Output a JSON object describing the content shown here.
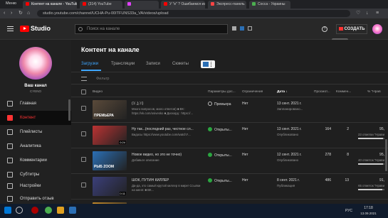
{
  "browser": {
    "menu_label": "Меню",
    "tabs": [
      {
        "label": "Контент на канале - YouTube",
        "color": "#ff0000"
      },
      {
        "label": "(314) YouTube",
        "color": "#ff0000"
      },
      {
        "label": "",
        "color": "#e040fb"
      },
      {
        "label": "У \"е\" ? Ошибаемся из-сол",
        "color": "#ff0000"
      },
      {
        "label": "Экспресс-панель",
        "color": "#ff4444"
      },
      {
        "label": "Сосса - Украины",
        "color": "#4caf50"
      }
    ],
    "url": "studio.youtube.com/channel/UCHA-Pu-00ITFUNS33a_VA/videos/upload"
  },
  "header": {
    "logo_text": "Studio",
    "search_placeholder": "Поиск на канале",
    "create_label": "СОЗДАТЬ",
    "create_tooltip": "Создать"
  },
  "sidebar": {
    "channel_name": "Ваш канал",
    "channel_sub": "CYENO",
    "items": [
      {
        "label": "Главная",
        "icon": "dashboard-icon"
      },
      {
        "label": "Контент",
        "icon": "content-icon",
        "active": true
      },
      {
        "label": "Плейлисты",
        "icon": "playlist-icon"
      },
      {
        "label": "Аналитика",
        "icon": "analytics-icon"
      },
      {
        "label": "Комментарии",
        "icon": "comments-icon"
      },
      {
        "label": "Субтитры",
        "icon": "subtitles-icon"
      },
      {
        "label": "Настройки",
        "icon": "settings-icon"
      },
      {
        "label": "Отправить отзыв",
        "icon": "feedback-icon"
      }
    ]
  },
  "main": {
    "title": "Контент на канале",
    "tabs": [
      "Загрузки",
      "Трансляции",
      "Записи",
      "Сюжеты"
    ],
    "filter_label": "Фильтр",
    "columns": {
      "video": "Видео",
      "visibility": "Параметры дос...",
      "restrictions": "Ограничения",
      "date": "Дата",
      "views": "Просмот...",
      "comments": "Коммен...",
      "likes": "% \"Нрав"
    },
    "rows": [
      {
        "title": "(ꈍ ͜ʖ ꈍ)",
        "desc": "Много вопросов, мало ответов) ■ ВК : https://vk.com/osivesko ■ Дискорд : https://...",
        "thumb_text": "ПРЕМЬЕРА",
        "thumb_bg": "#5a4a3a",
        "duration": "",
        "visibility": "Премьера",
        "public": false,
        "restriction": "Нет",
        "date": "13 сент. 2021 г.",
        "date_sub": "Запланировано...",
        "views": "",
        "comments": "",
        "likes": "",
        "likes_sub": "",
        "like_frac": 0
      },
      {
        "title": "Ну так...(последний раз, честное сл...",
        "desc": "Видосы https://www.youtube.com/watch?...",
        "thumb_text": "",
        "thumb_bg": "#b33",
        "duration": "0:24",
        "visibility": "Открыты...",
        "public": true,
        "restriction": "Нет",
        "date": "13 сент. 2021 г.",
        "date_sub": "Опубликовано",
        "views": "164",
        "comments": "2",
        "likes": "95,",
        "likes_sub": "23 отметки \"Нрави",
        "like_frac": 0.95
      },
      {
        "title": "Новое видео, но это не точно)",
        "desc": "Добавьте описание",
        "thumb_text": "РЫБ ZOOM",
        "thumb_bg": "#2b6fb5",
        "duration": "",
        "visibility": "Открыты...",
        "public": true,
        "restriction": "Нет",
        "date": "12 сент. 2021 г.",
        "date_sub": "Опубликовано",
        "views": "278",
        "comments": "8",
        "likes": "95,",
        "likes_sub": "40 отметок \"Нрави",
        "like_frac": 0.95
      },
      {
        "title": "ШОК, ПУТИН КИЛЛЕР",
        "desc": "Да-да, это самый крутой киллер в мире! Ссылки на меня: ■ ВК...",
        "thumb_text": "",
        "thumb_bg": "#3b3f7a",
        "duration": "0:11",
        "visibility": "Открыты...",
        "public": true,
        "restriction": "Нет",
        "date": "8 сент. 2021 г.",
        "date_sub": "Публикация",
        "views": "486",
        "comments": "13",
        "likes": "91,",
        "likes_sub": "65 отметок \"Нрави",
        "like_frac": 0.91
      },
      {
        "title": "ЛУЧШИЕ РЕАКЦИИ НА ДИСТАНЦИ...",
        "desc": "",
        "thumb_text": "",
        "thumb_bg": "#c58a2a",
        "duration": "",
        "visibility": "Открыты...",
        "public": true,
        "restriction": "Нет",
        "date": "5 сент. 2021 г.",
        "date_sub": "",
        "views": "487",
        "comments": "16",
        "likes": "96,",
        "likes_sub": "",
        "like_frac": 0.96
      }
    ]
  },
  "taskbar": {
    "lang": "РУС",
    "time": "17:18",
    "date": "13.09.2021"
  }
}
